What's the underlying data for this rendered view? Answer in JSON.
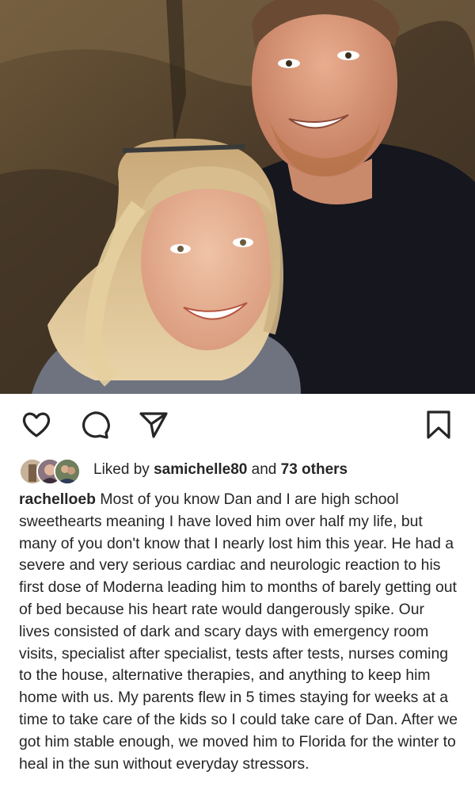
{
  "post": {
    "username": "rachelloeb",
    "caption": "Most of you know Dan and I are high school sweethearts meaning I have loved him over half my life, but many of you don't know that I nearly lost him this year. He had a severe and very serious cardiac and neurologic reaction to his first dose of Moderna leading him to months of barely getting out of bed because his heart rate would dangerously spike. Our lives consisted of dark and scary days with emergency room visits, specialist after specialist, tests after tests, nurses coming to the house, alternative therapies, and anything to keep him home with us. My parents flew in 5 times staying for weeks at a time to take care of the kids so I could take care of Dan. After we got him stable enough, we moved him to Florida for the winter to heal in the sun without everyday stressors."
  },
  "likes": {
    "prefix": "Liked by",
    "user": "samichelle80",
    "joiner": "and",
    "others": "73 others"
  },
  "icons": {
    "like": "heart-icon",
    "comment": "comment-bubble-icon",
    "share": "paper-plane-icon",
    "save": "bookmark-icon"
  },
  "colors": {
    "text": "#262626",
    "background": "#ffffff"
  }
}
